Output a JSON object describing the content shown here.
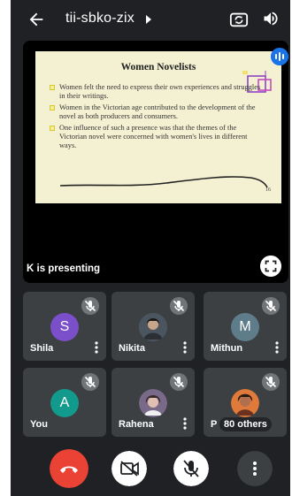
{
  "meeting": {
    "code": "tii-sbko-zix"
  },
  "presentation": {
    "presenter_label": "K is presenting",
    "slide": {
      "title": "Women Novelists",
      "bullets": [
        "Women felt the need to express their own experiences and struggles in their writings.",
        "Women in the Victorian age contributed to the development of the novel as both producers and consumers.",
        "One influence of such a presence was that the themes of the Victorian novel were concerned with women's lives in different ways."
      ],
      "page_number": "16"
    }
  },
  "participants": [
    {
      "name": "Shila",
      "initial": "S",
      "avatar_color": "#7b4fc9"
    },
    {
      "name": "Nikita",
      "initial": "",
      "avatar_color": "#55606a"
    },
    {
      "name": "Mithun",
      "initial": "M",
      "avatar_color": "#5f7c8a"
    },
    {
      "name": "You",
      "initial": "A",
      "avatar_color": "#129a8c"
    },
    {
      "name": "Rahena",
      "initial": "",
      "avatar_color": "#6b5b7a"
    },
    {
      "name": "P",
      "initial": "",
      "avatar_color": "#8a5a3c",
      "others_label": "80 others"
    }
  ],
  "icons": {
    "back": "arrow-left-icon",
    "title_menu": "caret-right-icon",
    "switch_camera": "switch-camera-icon",
    "audio_output": "speaker-icon",
    "mic_off": "mic-off-icon",
    "more": "more-vert-icon",
    "fullscreen": "fullscreen-icon",
    "hang_up": "call-end-icon",
    "camera_off": "videocam-off-icon"
  },
  "colors": {
    "background": "#202124",
    "tile": "#3c4043",
    "hangup": "#ea4335",
    "speaking": "#1a73e8",
    "slide_bg": "#f4f1d3"
  }
}
